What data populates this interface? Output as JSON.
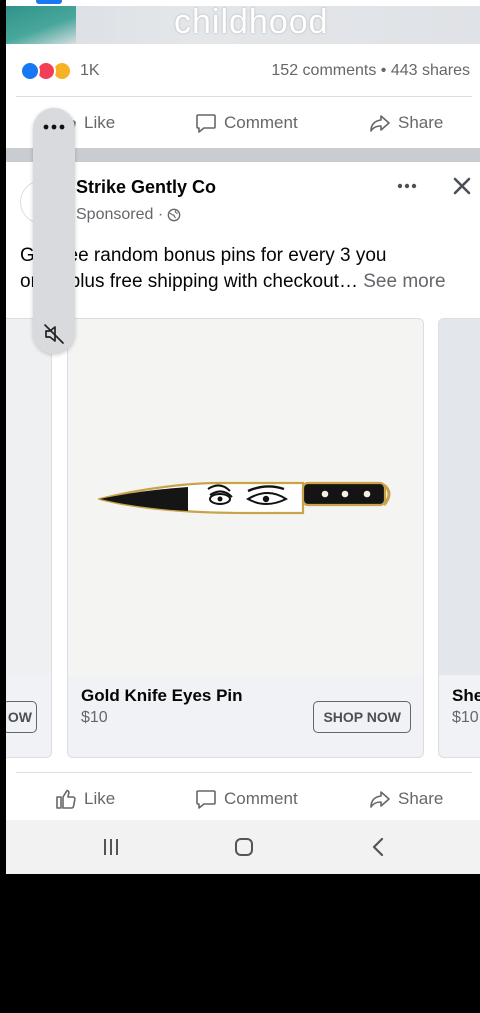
{
  "previous_post": {
    "image_caption": "childhood",
    "reaction_count": "1K",
    "stats": "152 comments • 443 shares",
    "actions": {
      "like": "Like",
      "comment": "Comment",
      "share": "Share"
    }
  },
  "sponsored_post": {
    "page_name": "Strike Gently Co",
    "sponsored_label": "Sponsored ·",
    "text_line1": "Get free random bonus pins for every 3 you",
    "text_line2": "order plus free shipping with checkout…",
    "see_more": "See more",
    "carousel": [
      {
        "title": "",
        "price": "",
        "cta": "OW"
      },
      {
        "title": "Gold Knife Eyes Pin",
        "price": "$10",
        "cta": "SHOP NOW"
      },
      {
        "title": "She",
        "price": "$10",
        "cta": ""
      }
    ],
    "actions": {
      "like": "Like",
      "comment": "Comment",
      "share": "Share"
    }
  },
  "colors": {
    "accent": "#1877f2",
    "muted_text": "#65676b",
    "divider": "#dadde1"
  },
  "icons": [
    "like-icon",
    "comment-icon",
    "share-icon",
    "globe-icon",
    "more-icon",
    "close-icon",
    "mute-icon",
    "recents-icon",
    "home-icon",
    "back-icon"
  ]
}
